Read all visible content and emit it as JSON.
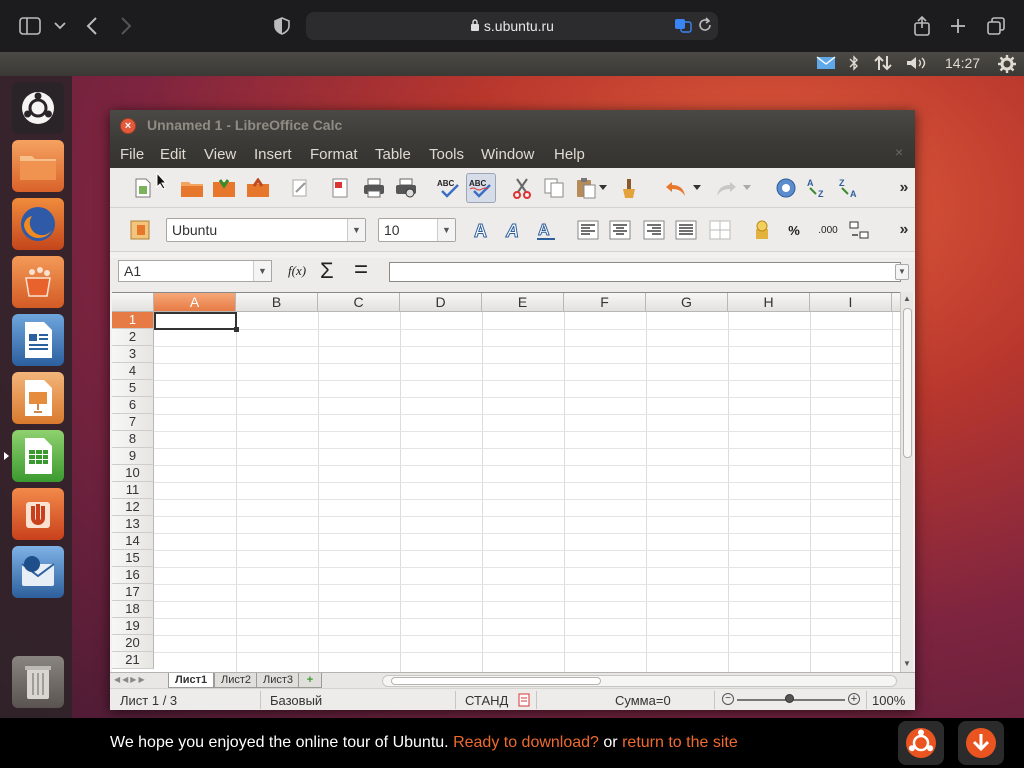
{
  "safari": {
    "url": "s.ubuntu.ru"
  },
  "panel": {
    "time": "14:27"
  },
  "window": {
    "title": "Unnamed 1 - LibreOffice Calc",
    "menu": [
      "File",
      "Edit",
      "View",
      "Insert",
      "Format",
      "Table",
      "Tools",
      "Window",
      "Help"
    ]
  },
  "toolbar2": {
    "font_name": "Ubuntu",
    "font_size": "10",
    "percent_label": "%",
    "decimal_label": ".000"
  },
  "formula": {
    "cell_ref": "A1",
    "fx_label": "f(x)",
    "sum_label": "Σ",
    "equals_label": "=",
    "value": ""
  },
  "grid": {
    "columns": [
      "A",
      "B",
      "C",
      "D",
      "E",
      "F",
      "G",
      "H",
      "I"
    ],
    "rows": [
      "1",
      "2",
      "3",
      "4",
      "5",
      "6",
      "7",
      "8",
      "9",
      "10",
      "11",
      "12",
      "13",
      "14",
      "15",
      "16",
      "17",
      "18",
      "19",
      "20",
      "21"
    ],
    "active_cell": "A1"
  },
  "sheets": {
    "tabs": [
      "Лист1",
      "Лист2",
      "Лист3"
    ],
    "active": "Лист1"
  },
  "status": {
    "sheet_info": "Лист 1 / 3",
    "page_style": "Базовый",
    "mode": "СТАНД",
    "sum": "Сумма=0",
    "zoom": "100%"
  },
  "banner": {
    "text_before": "We hope you enjoyed the online tour of Ubuntu.",
    "link_download": "Ready to download?",
    "text_or": "or",
    "link_return": "return to the site"
  },
  "colors": {
    "accent_orange": "#e77b45",
    "banner_link": "#ef6a2f",
    "close_button": "#e35a3a"
  }
}
